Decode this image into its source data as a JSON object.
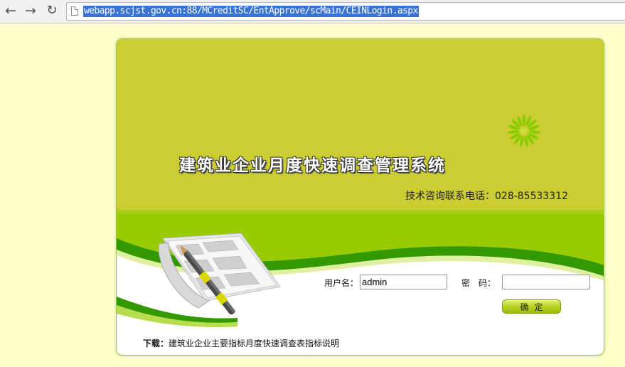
{
  "browser": {
    "nav_back_glyph": "←",
    "nav_forward_glyph": "→",
    "reload_glyph": "↻",
    "url": "webapp.scjst.gov.cn:88/MCreditSC/EntApprove/scMain/CEINLogin.aspx"
  },
  "banner": {
    "title": "建筑业企业月度快速调查管理系统",
    "hotline_label": "技术咨询联系电话：",
    "hotline_number": "028-85533312"
  },
  "login": {
    "username_label": "用户名：",
    "username_value": "admin",
    "password_label": "密　码：",
    "password_value": "",
    "submit_label": "确定"
  },
  "footer": {
    "download_label": "下载：",
    "download_link": "建筑业企业主要指标月度快速调查表指标说明"
  },
  "colors": {
    "page_bg": "#ffffcc",
    "banner_olive": "#cccc33",
    "band_green": "#99cc00",
    "accent_dark_green": "#339900"
  }
}
